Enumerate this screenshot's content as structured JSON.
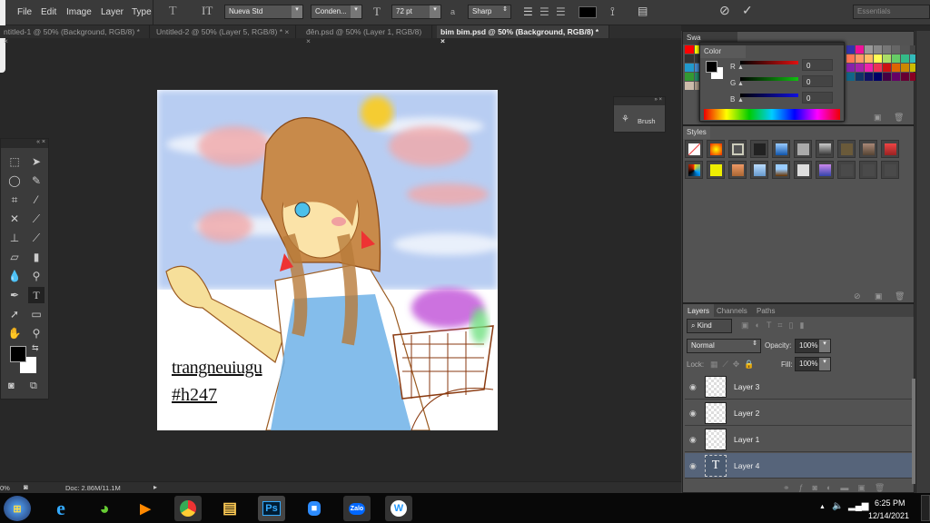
{
  "menu": [
    "File",
    "Edit",
    "Image",
    "Layer",
    "Type"
  ],
  "options": {
    "font_family": "Nueva Std",
    "font_style": "Conden...",
    "font_size": "72 pt",
    "aa_label": "a",
    "antialias": "Sharp",
    "workspace": "Essentials"
  },
  "tabs": [
    {
      "label": "ntitled-1 @ 50% (Background, RGB/8) *",
      "active": false
    },
    {
      "label": "Untitled-2 @ 50% (Layer 5, RGB/8) *",
      "active": false
    },
    {
      "label": "đên.psd @ 50% (Layer 1, RGB/8)",
      "active": false
    },
    {
      "label": "bim bim.psd @ 50% (Background, RGB/8) *",
      "active": true
    }
  ],
  "close_glyph": "×",
  "canvas": {
    "text_line1": "trangneuiugu",
    "text_line2": "#h247"
  },
  "brush_panel": {
    "label": "Brush"
  },
  "swatches_panel": {
    "title": "Swa"
  },
  "color_panel": {
    "title": "Color",
    "channels": [
      {
        "label": "R",
        "value": "0",
        "color": "#e01010"
      },
      {
        "label": "G",
        "value": "0",
        "color": "#10c010"
      },
      {
        "label": "B",
        "value": "0",
        "color": "#1010e0"
      }
    ],
    "foreground": "#000000",
    "background": "#ffffff"
  },
  "styles_panel": {
    "title": "Styles"
  },
  "layers_panel": {
    "tabs": [
      "Layers",
      "Channels",
      "Paths"
    ],
    "filter": "Kind",
    "blend_mode": "Normal",
    "opacity_label": "Opacity:",
    "opacity": "100%",
    "lock_label": "Lock:",
    "fill_label": "Fill:",
    "fill": "100%",
    "layers": [
      {
        "name": "Layer 3",
        "type": "raster"
      },
      {
        "name": "Layer 2",
        "type": "raster"
      },
      {
        "name": "Layer 1",
        "type": "raster"
      },
      {
        "name": "Layer 4",
        "type": "text",
        "selected": true
      }
    ]
  },
  "status": {
    "zoom": "0%",
    "doc": "Doc: 2.86M/11.1M"
  },
  "taskbar": {
    "apps": [
      "start",
      "ie",
      "coccoc",
      "media",
      "chrome",
      "explorer",
      "Ps",
      "zoom",
      "Zalo",
      "W"
    ],
    "time": "6:25 PM",
    "date": "12/14/2021"
  }
}
